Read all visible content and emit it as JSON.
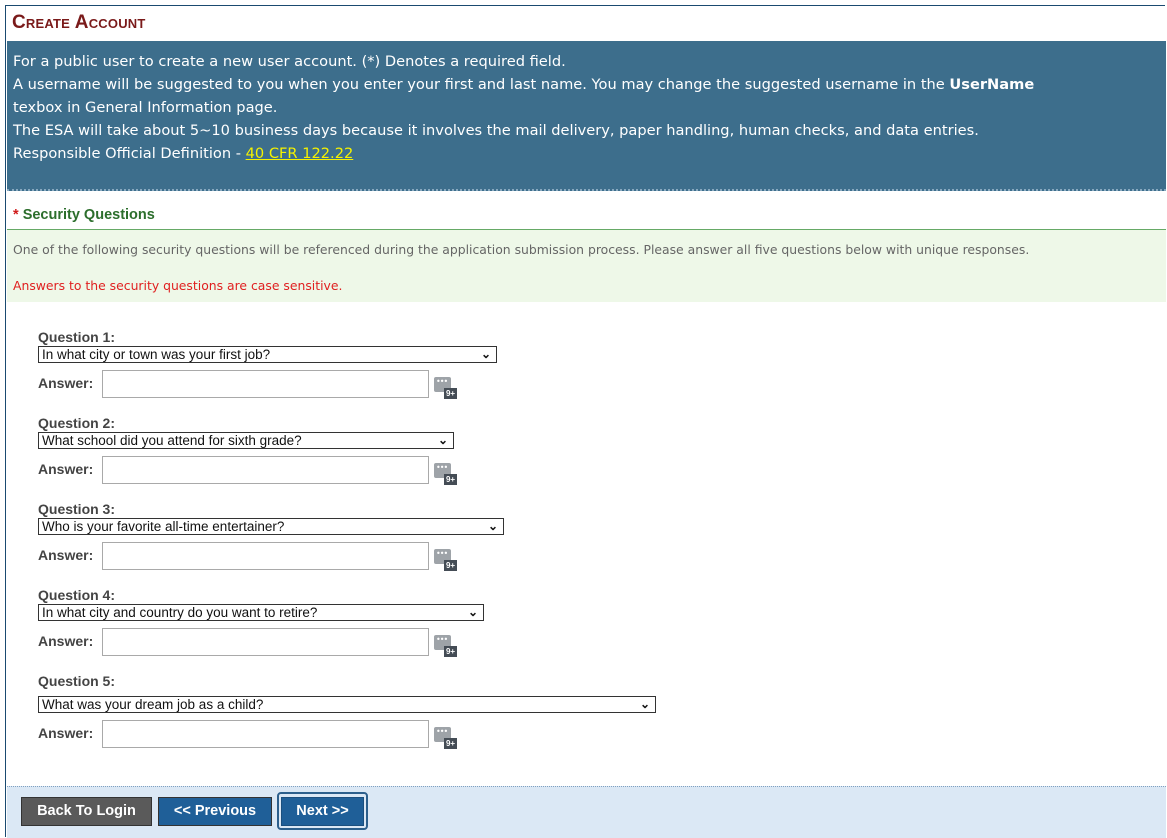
{
  "page": {
    "title": "Create Account"
  },
  "info": {
    "line1": "For a public user to create a new user account. (*) Denotes a required field.",
    "line2_pre": "A username will be suggested to you when you enter your first and last name. You may change the suggested username in the ",
    "line2_bold": "UserName",
    "line3": "texbox in General Information page.",
    "line4": "The ESA will take about 5~10 business days because it involves the mail delivery, paper handling, human checks, and data entries.",
    "line5_pre": "Responsible Official Definition - ",
    "line5_link": "40 CFR 122.22"
  },
  "section": {
    "required_mark": "*",
    "title": "Security Questions"
  },
  "notice": {
    "text": "One of the following security questions will be referenced during the application submission process. Please answer all five questions below with unique responses.",
    "warning": "Answers to the security questions are case sensitive."
  },
  "questions": [
    {
      "label": "Question 1:",
      "selected": "In what city or town was your first job?",
      "answer_label": "Answer:",
      "answer_value": ""
    },
    {
      "label": "Question 2:",
      "selected": "What school did you attend for sixth grade?",
      "answer_label": "Answer:",
      "answer_value": ""
    },
    {
      "label": "Question 3:",
      "selected": "Who is your favorite all-time entertainer?",
      "answer_label": "Answer:",
      "answer_value": ""
    },
    {
      "label": "Question 4:",
      "selected": "In what city and country do you want to retire?",
      "answer_label": "Answer:",
      "answer_value": ""
    },
    {
      "label": "Question 5:",
      "selected": "What was your dream job as a child?",
      "answer_label": "Answer:",
      "answer_value": ""
    }
  ],
  "icons": {
    "dropdown": "chevron-down-icon",
    "keyboard": "virtual-keyboard-icon",
    "keyboard_badge": "9+"
  },
  "buttons": {
    "back": "Back To Login",
    "previous": "<< Previous",
    "next": "Next >>"
  },
  "colors": {
    "title": "#7a1a1a",
    "info_bg": "#3d6e8c",
    "link": "#f5f200",
    "section_title": "#2c6e2c",
    "warning": "#e02020",
    "button": "#1f5f98",
    "button_gray": "#5a5a5a"
  }
}
